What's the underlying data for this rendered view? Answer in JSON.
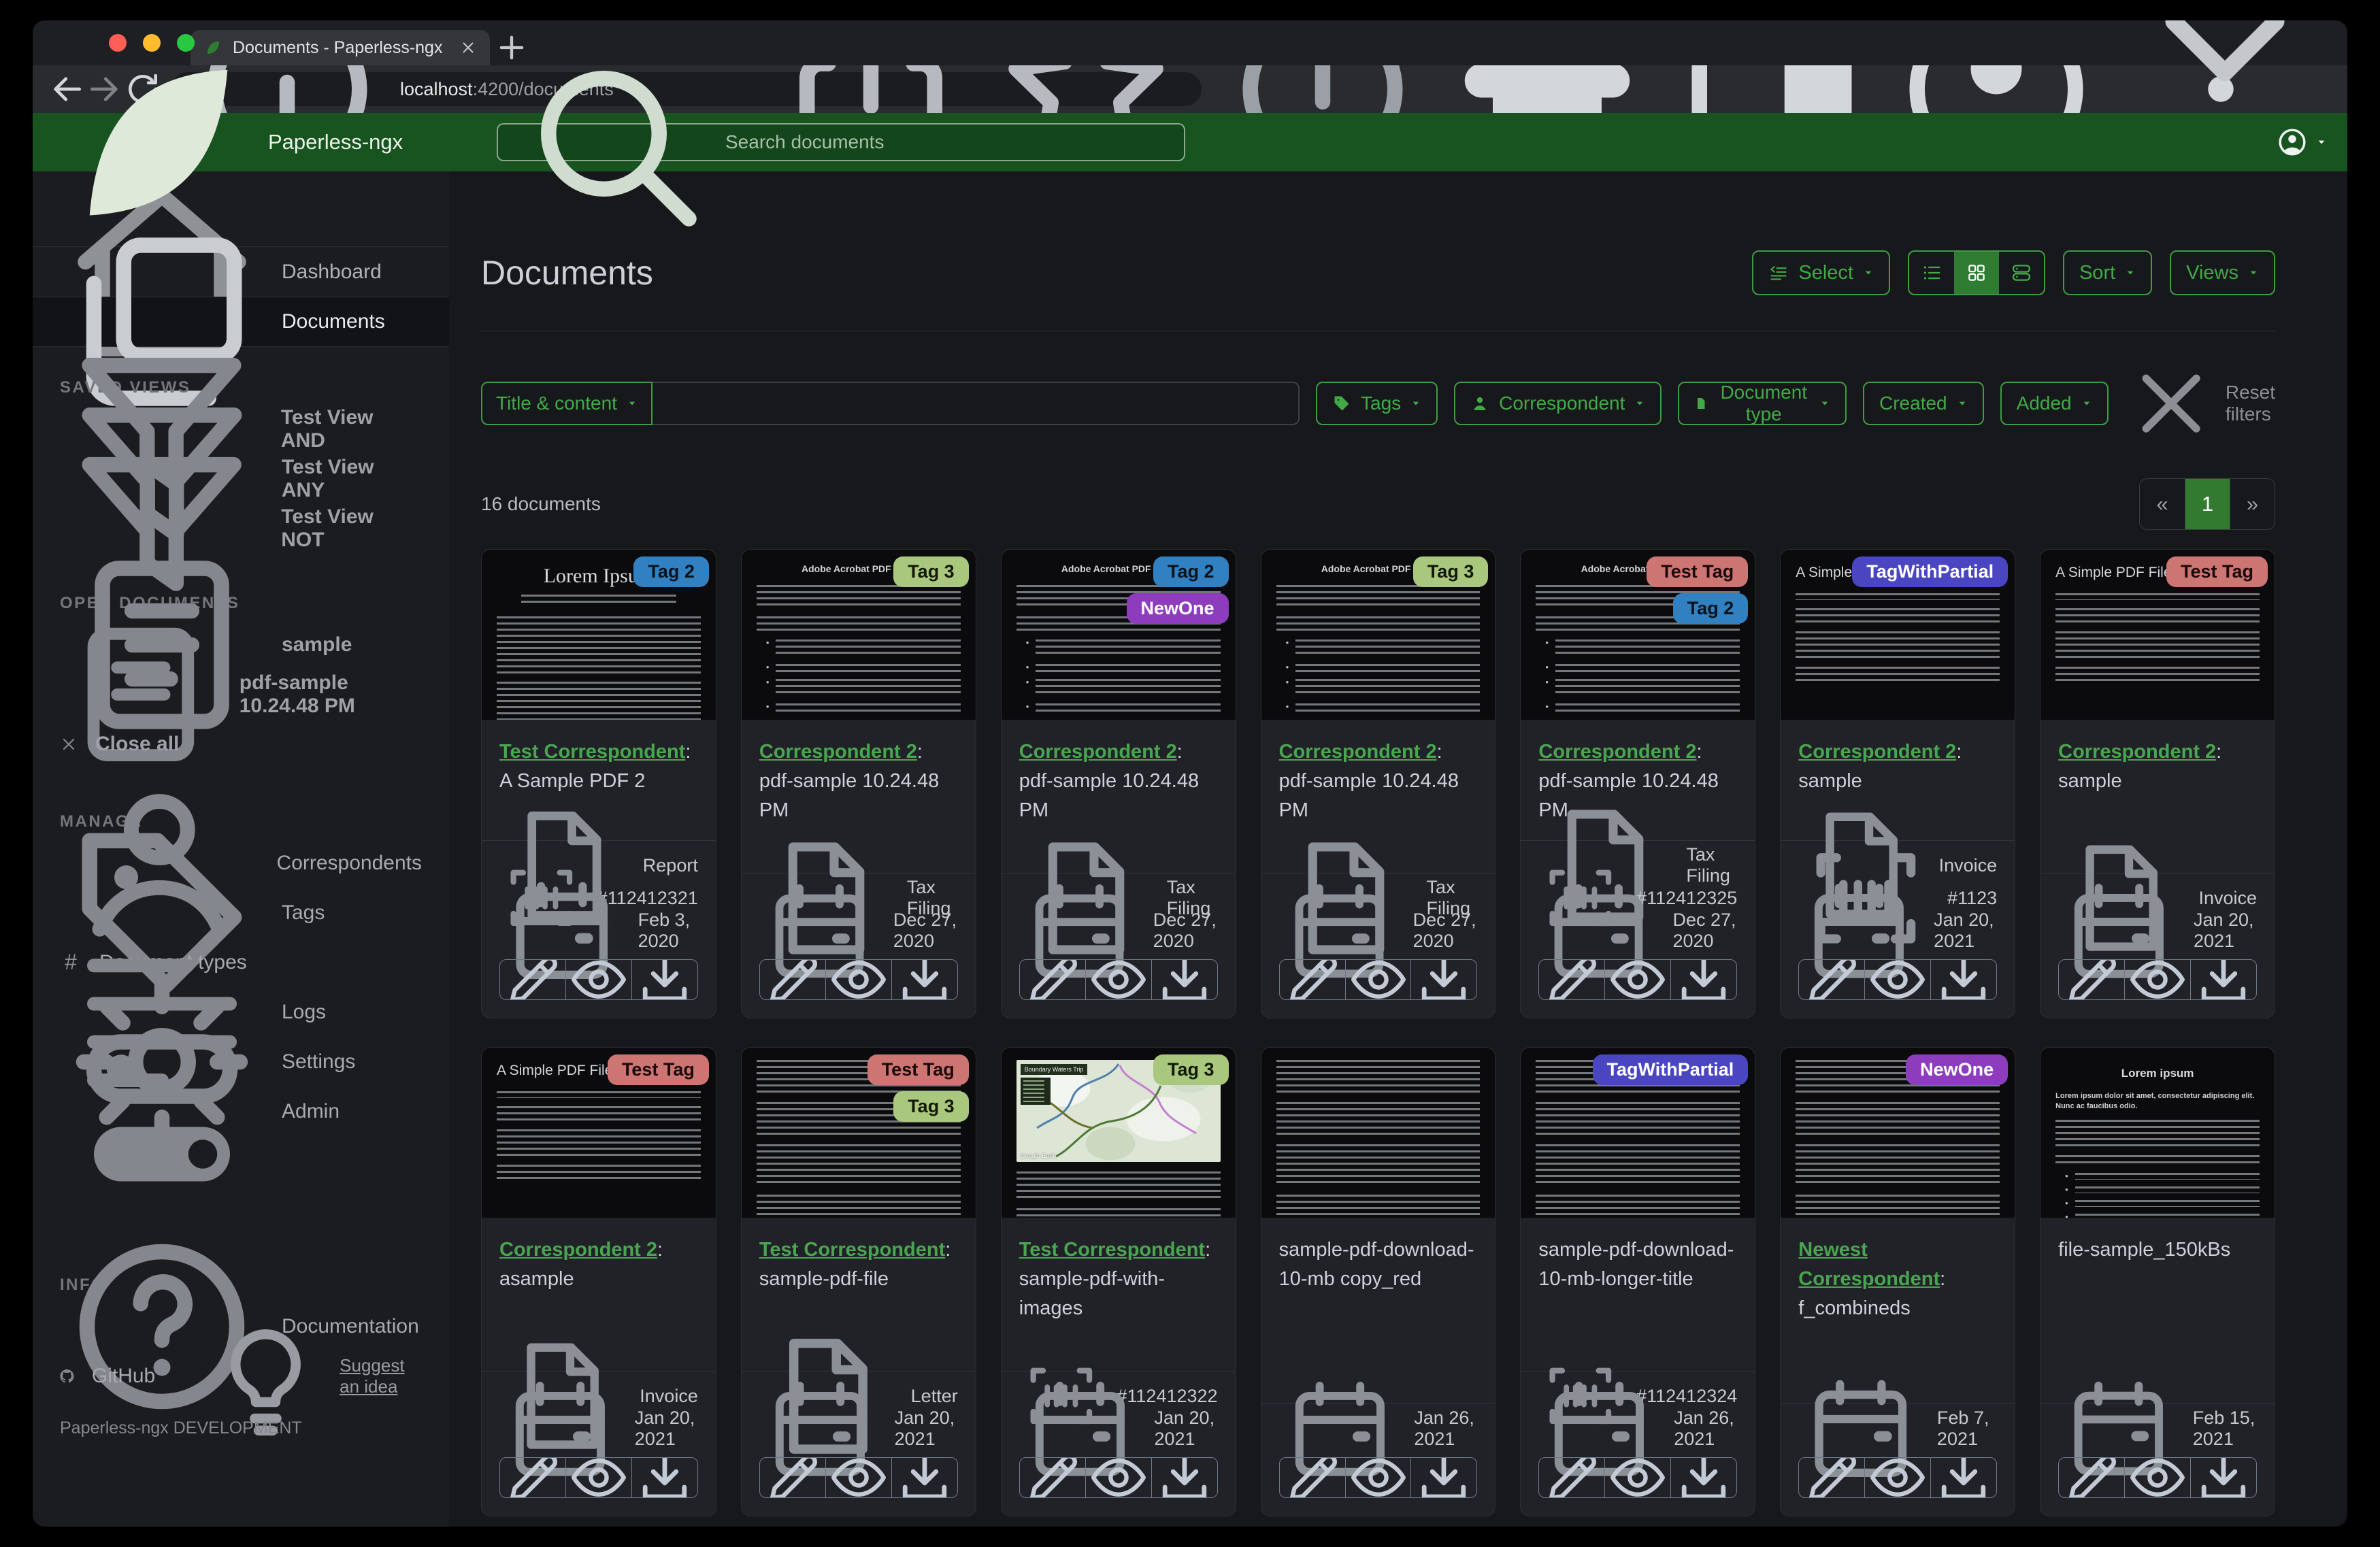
{
  "browser": {
    "tab_title": "Documents - Paperless-ngx",
    "url_host": "localhost",
    "url_path": ":4200/documents"
  },
  "header": {
    "brand": "Paperless-ngx",
    "search_placeholder": "Search documents"
  },
  "sidebar": {
    "nav": [
      "Dashboard",
      "Documents"
    ],
    "saved_views_title": "SAVED VIEWS",
    "saved_views": [
      "Test View AND",
      "Test View ANY",
      "Test View NOT"
    ],
    "open_documents_title": "OPEN DOCUMENTS",
    "open_documents": [
      "sample",
      "pdf-sample 10.24.48 PM"
    ],
    "close_all": "Close all",
    "manage_title": "MANAGE",
    "manage": [
      "Correspondents",
      "Tags",
      "Document types",
      "Logs",
      "Settings",
      "Admin"
    ],
    "info_title": "INFO",
    "info_items": [
      "Documentation",
      "GitHub"
    ],
    "suggest_idea": "Suggest an idea",
    "footer": "Paperless-ngx DEVELOPMENT"
  },
  "main": {
    "title": "Documents",
    "toolbar": {
      "select": "Select",
      "sort": "Sort",
      "views": "Views"
    },
    "filters": {
      "field": "Title & content",
      "text_value": "",
      "tags": "Tags",
      "correspondent": "Correspondent",
      "document_type": "Document type",
      "created": "Created",
      "added": "Added",
      "reset": "Reset filters"
    },
    "count": "16 documents",
    "pager": {
      "prev": "«",
      "page": "1",
      "next": "»"
    }
  },
  "colors": {
    "brand_green": "#17541f",
    "accent_green": "#41aa47",
    "accent_border": "#3f9a45",
    "active_green": "#2f7d33",
    "pagination_active": "#337a31",
    "link_green": "#4aa551",
    "traffic_red": "#ff5f57",
    "traffic_yellow": "#febc2e",
    "traffic_green": "#28c840"
  },
  "tag_colors": {
    "Tag 2": {
      "bg": "#3080c2",
      "fg": "#06121c"
    },
    "Tag 3": {
      "bg": "#a9c87d",
      "fg": "#131803"
    },
    "Test Tag": {
      "bg": "#cc7573",
      "fg": "#1c0909"
    },
    "NewOne": {
      "bg": "#8d3cbe",
      "fg": "#ffffff"
    },
    "TagWithPartial": {
      "bg": "#4a45c0",
      "fg": "#ffffff"
    }
  },
  "icons": [
    "leaf-icon",
    "search-icon",
    "user-avatar-icon",
    "home-icon",
    "documents-icon",
    "filter-funnel-icon",
    "file-text-icon",
    "close-icon",
    "person-icon",
    "tag-icon",
    "hash-icon",
    "logs-icon",
    "gear-icon",
    "admin-toggles-icon",
    "question-circle-icon",
    "github-icon",
    "lightbulb-icon",
    "select-icon",
    "list-view-icon",
    "grid-view-icon",
    "detail-view-icon",
    "file-icon",
    "barcode-icon",
    "calendar-icon",
    "pencil-icon",
    "eye-icon",
    "download-icon",
    "share-icon",
    "star-icon",
    "extension-icon",
    "puzzle-icon",
    "side-panel-icon",
    "kebab-menu-icon",
    "info-icon",
    "back-icon",
    "forward-icon",
    "reload-icon",
    "chevron-down-icon"
  ],
  "documents": [
    {
      "tags": [
        "Tag 2"
      ],
      "correspondent": "Test Correspondent",
      "title": ": A Sample PDF 2",
      "type": "Report",
      "asn": "#112412321",
      "date": "Feb 3, 2020",
      "thumb": {
        "variant": "lorem",
        "heading": "Lorem Ipsum"
      }
    },
    {
      "tags": [
        "Tag 3"
      ],
      "correspondent": "Correspondent 2",
      "title": ": pdf-sample 10.24.48 PM",
      "type": "Tax Filing",
      "asn": null,
      "date": "Dec 27, 2020",
      "thumb": {
        "variant": "acrobat",
        "heading": "Adobe Acrobat PDF Files"
      }
    },
    {
      "tags": [
        "Tag 2",
        "NewOne"
      ],
      "correspondent": "Correspondent 2",
      "title": ": pdf-sample 10.24.48 PM",
      "type": "Tax Filing",
      "asn": null,
      "date": "Dec 27, 2020",
      "thumb": {
        "variant": "acrobat",
        "heading": "Adobe Acrobat PDF Files"
      }
    },
    {
      "tags": [
        "Tag 3"
      ],
      "correspondent": "Correspondent 2",
      "title": ": pdf-sample 10.24.48 PM",
      "type": "Tax Filing",
      "asn": null,
      "date": "Dec 27, 2020",
      "thumb": {
        "variant": "acrobat",
        "heading": "Adobe Acrobat PDF Files"
      }
    },
    {
      "tags": [
        "Test Tag",
        "Tag 2"
      ],
      "correspondent": "Correspondent 2",
      "title": ": pdf-sample 10.24.48 PM",
      "type": "Tax Filing",
      "asn": "#112412325",
      "date": "Dec 27, 2020",
      "thumb": {
        "variant": "acrobat",
        "heading": "Adobe Acrobat PDF Files"
      }
    },
    {
      "tags": [
        "TagWithPartial"
      ],
      "correspondent": "Correspondent 2",
      "title": ": sample",
      "type": "Invoice",
      "asn": "#1123",
      "date": "Jan 20, 2021",
      "thumb": {
        "variant": "simple",
        "heading": "A Simple PDF File"
      }
    },
    {
      "tags": [
        "Test Tag"
      ],
      "correspondent": "Correspondent 2",
      "title": ": sample",
      "type": "Invoice",
      "asn": null,
      "date": "Jan 20, 2021",
      "thumb": {
        "variant": "simple",
        "heading": "A Simple PDF File"
      }
    },
    {
      "tags": [
        "Test Tag"
      ],
      "correspondent": "Correspondent 2",
      "title": ": asample",
      "type": "Invoice",
      "asn": null,
      "date": "Jan 20, 2021",
      "thumb": {
        "variant": "simple",
        "heading": "A Simple PDF File"
      }
    },
    {
      "tags": [
        "Test Tag",
        "Tag 3"
      ],
      "correspondent": "Test Correspondent",
      "title": ": sample-pdf-file",
      "type": "Letter",
      "asn": null,
      "date": "Jan 20, 2021",
      "thumb": {
        "variant": "dense",
        "heading": ""
      }
    },
    {
      "tags": [
        "Tag 3"
      ],
      "correspondent": "Test Correspondent",
      "title": ": sample-pdf-with-images",
      "type": null,
      "asn": "#112412322",
      "date": "Jan 20, 2021",
      "thumb": {
        "variant": "map",
        "heading": "Boundary Waters Trip",
        "watermark": "Google Earth"
      }
    },
    {
      "tags": [],
      "correspondent": null,
      "title": "sample-pdf-download-10-mb copy_red",
      "type": null,
      "asn": null,
      "date": "Jan 26, 2021",
      "thumb": {
        "variant": "dense",
        "heading": ""
      }
    },
    {
      "tags": [
        "TagWithPartial"
      ],
      "correspondent": null,
      "title": "sample-pdf-download-10-mb-longer-title",
      "type": null,
      "asn": "#112412324",
      "date": "Jan 26, 2021",
      "thumb": {
        "variant": "dense",
        "heading": ""
      }
    },
    {
      "tags": [
        "NewOne"
      ],
      "correspondent": "Newest Correspondent",
      "title": ": f_combineds",
      "type": null,
      "asn": null,
      "date": "Feb 7, 2021",
      "thumb": {
        "variant": "dense",
        "heading": ""
      }
    },
    {
      "tags": [],
      "correspondent": null,
      "title": "file-sample_150kBs",
      "type": null,
      "asn": null,
      "date": "Feb 15, 2021",
      "thumb": {
        "variant": "lorem2",
        "heading": "Lorem ipsum",
        "subheading": "Lorem ipsum dolor sit amet, consectetur adipiscing elit. Nunc ac faucibus odio."
      }
    }
  ]
}
